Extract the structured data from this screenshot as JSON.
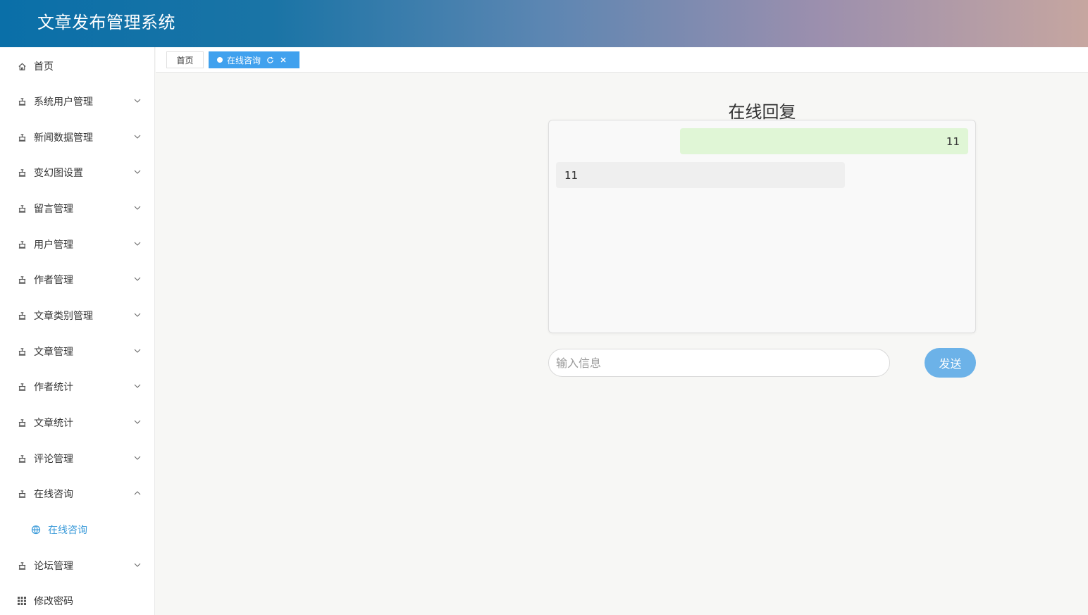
{
  "header": {
    "title": "文章发布管理系统"
  },
  "sidebar": {
    "items": [
      {
        "label": "首页",
        "icon": "home-icon"
      },
      {
        "label": "系统用户管理",
        "icon": "menu-icon"
      },
      {
        "label": "新闻数据管理",
        "icon": "menu-icon"
      },
      {
        "label": "变幻图设置",
        "icon": "menu-icon"
      },
      {
        "label": "留言管理",
        "icon": "menu-icon"
      },
      {
        "label": "用户管理",
        "icon": "menu-icon"
      },
      {
        "label": "作者管理",
        "icon": "menu-icon"
      },
      {
        "label": "文章类别管理",
        "icon": "menu-icon"
      },
      {
        "label": "文章管理",
        "icon": "menu-icon"
      },
      {
        "label": "作者统计",
        "icon": "menu-icon"
      },
      {
        "label": "文章统计",
        "icon": "menu-icon"
      },
      {
        "label": "评论管理",
        "icon": "menu-icon"
      },
      {
        "label": "在线咨询",
        "icon": "menu-icon",
        "expanded": true
      },
      {
        "label": "在线咨询",
        "icon": "globe-icon",
        "sub": true,
        "active": true
      },
      {
        "label": "论坛管理",
        "icon": "menu-icon"
      },
      {
        "label": "修改密码",
        "icon": "grid-icon"
      }
    ]
  },
  "tabs": [
    {
      "label": "首页"
    },
    {
      "label": "在线咨询",
      "active": true
    }
  ],
  "chat": {
    "title": "在线回复",
    "messages": [
      {
        "side": "right",
        "text": "11"
      },
      {
        "side": "left",
        "text": "11"
      }
    ],
    "input_placeholder": "输入信息",
    "input_value": "",
    "send_label": "发送"
  },
  "colors": {
    "accent": "#40a1ee",
    "send_button": "#6cb2e8",
    "sub_menu_active": "#3a9ad9",
    "msg_right_bg": "#e0f6d6",
    "msg_left_bg": "#efefef"
  }
}
